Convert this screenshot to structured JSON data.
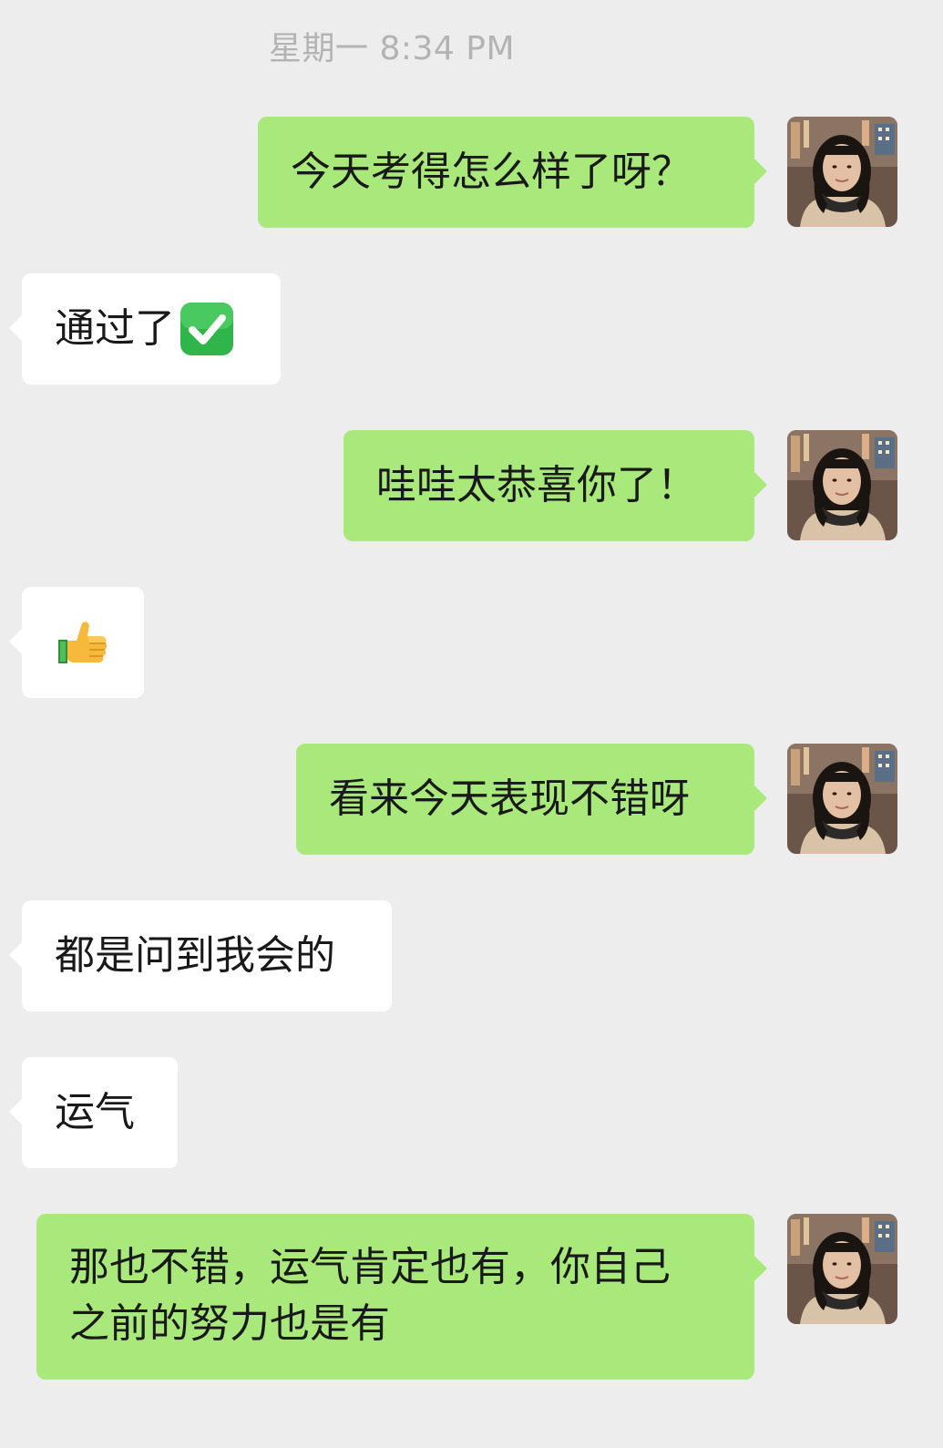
{
  "chat": {
    "timestamp": "星期一 8:34 PM",
    "messages": [
      {
        "id": "m1",
        "direction": "out",
        "text": "今天考得怎么样了呀？"
      },
      {
        "id": "m2",
        "direction": "in",
        "text": "通过了",
        "trailing_icon": "check-mark-button-emoji"
      },
      {
        "id": "m3",
        "direction": "out",
        "text": "哇哇太恭喜你了！"
      },
      {
        "id": "m4",
        "direction": "in",
        "text": "",
        "trailing_icon": "thumbs-up-emoji"
      },
      {
        "id": "m5",
        "direction": "out",
        "text": "看来今天表现不错呀"
      },
      {
        "id": "m6",
        "direction": "in",
        "text": "都是问到我会的"
      },
      {
        "id": "m7",
        "direction": "in",
        "text": "运气"
      },
      {
        "id": "m8",
        "direction": "out",
        "lines": [
          "那也不错，运气肯定也有，你自己",
          "之前的努力也是有"
        ]
      }
    ]
  },
  "colors": {
    "background": "#ededed",
    "outgoing_bubble": "#a9e97c",
    "incoming_bubble": "#ffffff",
    "text": "#191919",
    "timestamp": "#b3b3b3"
  }
}
